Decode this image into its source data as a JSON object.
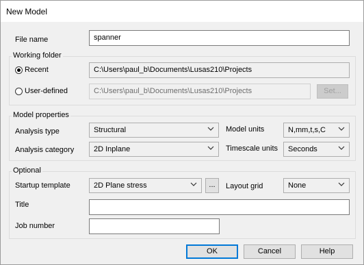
{
  "window": {
    "title": "New Model"
  },
  "file_name": {
    "label": "File name",
    "value": "spanner"
  },
  "working_folder": {
    "legend": "Working folder",
    "recent_label": "Recent",
    "recent_path": "C:\\Users\\paul_b\\Documents\\Lusas210\\Projects",
    "user_defined_label": "User-defined",
    "user_defined_path": "C:\\Users\\paul_b\\Documents\\Lusas210\\Projects",
    "set_button": "Set...",
    "selected": "Recent"
  },
  "model_properties": {
    "legend": "Model properties",
    "analysis_type_label": "Analysis type",
    "analysis_type_value": "Structural",
    "analysis_category_label": "Analysis category",
    "analysis_category_value": "2D Inplane",
    "model_units_label": "Model units",
    "model_units_value": "N,mm,t,s,C",
    "timescale_units_label": "Timescale units",
    "timescale_units_value": "Seconds"
  },
  "optional": {
    "legend": "Optional",
    "startup_template_label": "Startup template",
    "startup_template_value": "2D Plane stress",
    "browse_button": "...",
    "layout_grid_label": "Layout grid",
    "layout_grid_value": "None",
    "title_label": "Title",
    "title_value": "",
    "job_number_label": "Job number",
    "job_number_value": ""
  },
  "buttons": {
    "ok": "OK",
    "cancel": "Cancel",
    "help": "Help"
  },
  "colors": {
    "focus_border": "#0078d7",
    "dialog_bg": "#f0f0f0"
  }
}
